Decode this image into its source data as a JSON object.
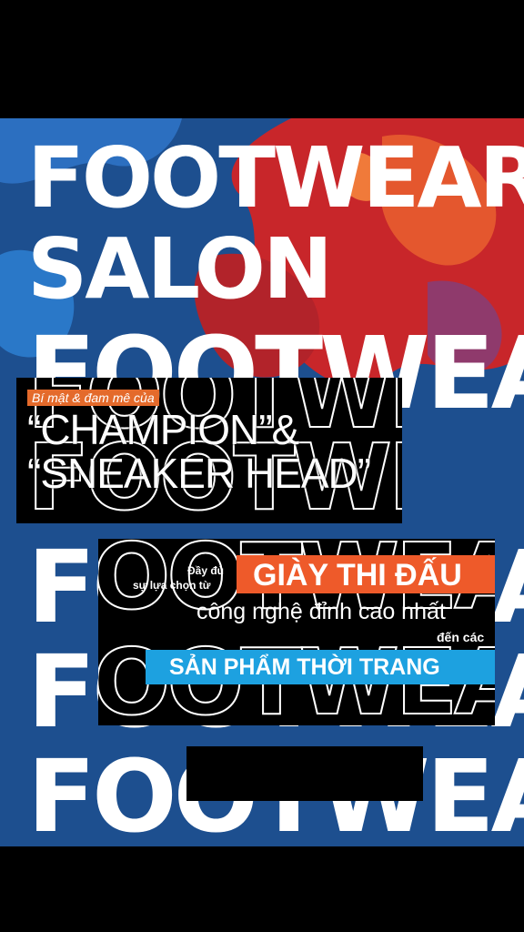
{
  "title_line1": "FOOTWEAR",
  "title_line2": "SALON",
  "bg_word": "FOOTWEAR",
  "tag_line": "Bí mật & đam mê của",
  "champion_line1": "“CHAMPION”&",
  "champion_line2": "“SNEAKER HEAD”",
  "intro_line1": "Đầy đủ",
  "intro_line2": "sự lựa chọn từ",
  "giay_thi_dau": "GIÀY THI ĐẤU",
  "cong_nghe": "công nghệ đỉnh cao nhất",
  "den_cac": "đến các",
  "san_pham": "SẢN PHẨM THỜI TRANG",
  "colors": {
    "panel_blue": "#1d4f8f",
    "orange": "#ee5a2a",
    "tag_orange": "#e46a2b",
    "cyan": "#1da1e0",
    "splash_red": "#c8262a"
  }
}
